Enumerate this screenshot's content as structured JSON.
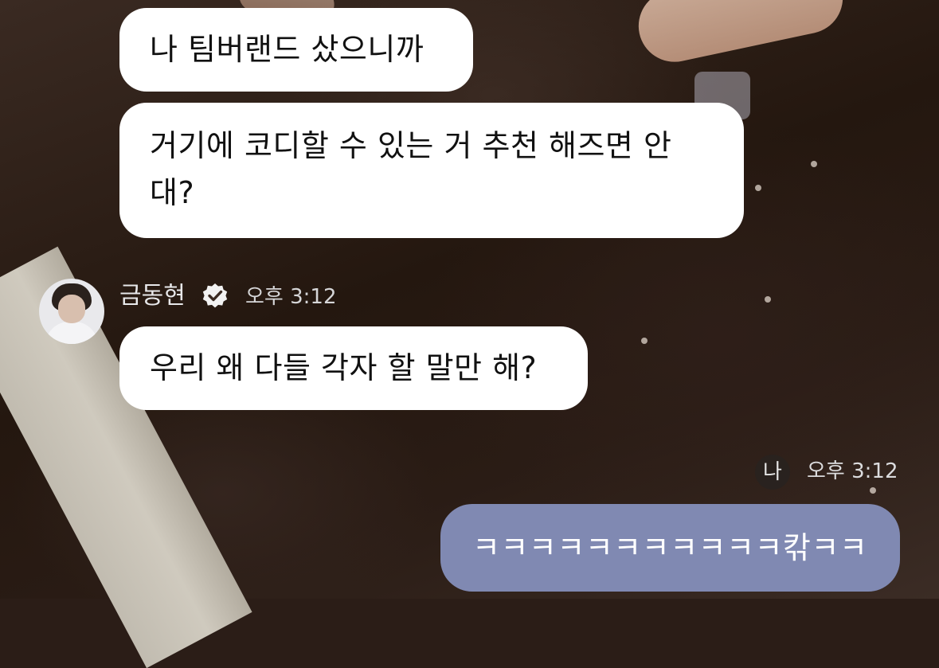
{
  "messages": [
    {
      "text": "나 팀버랜드 샀으니까"
    },
    {
      "text": "거기에 코디할 수 있는 거 추천 해즈면 안\n대?"
    },
    {
      "text": "우리 왜 다들 각자 할 말만 해?"
    }
  ],
  "sender": {
    "name": "금동현",
    "time": "오후 3:12",
    "verified_icon": "verified-check-icon",
    "avatar": "avatar-photo"
  },
  "me": {
    "badge": "나",
    "time": "오후 3:12",
    "message": "ㅋㅋㅋㅋㅋㅋㅋㅋㅋㅋㅋ칶ㅋㅋ"
  },
  "colors": {
    "incoming_bubble": "#ffffff",
    "outgoing_bubble": "#8089b2",
    "verified_badge": "#ffffff"
  }
}
